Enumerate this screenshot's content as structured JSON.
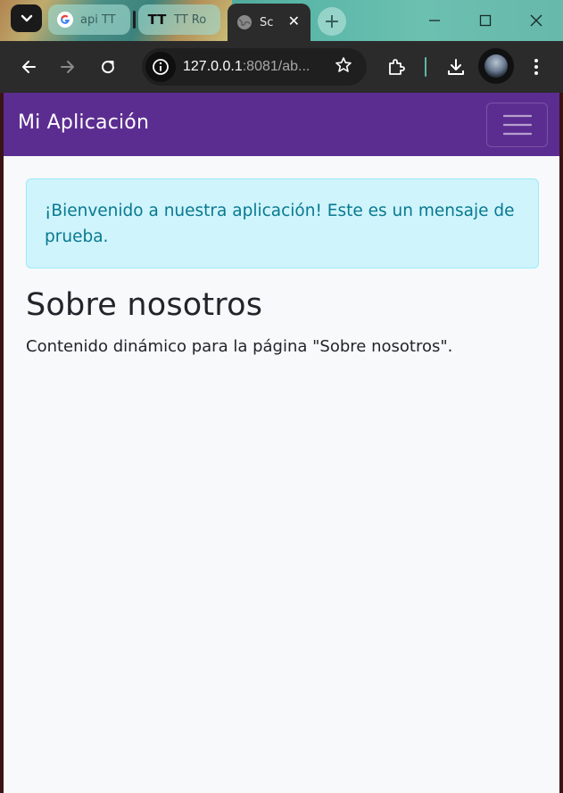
{
  "browser": {
    "tabs": [
      {
        "title": "api TT",
        "icon": "google-icon"
      },
      {
        "title": "TT Ro",
        "icon": "tt-icon",
        "icon_text": "TT"
      },
      {
        "title": "Sc",
        "icon": "globe-icon",
        "active": true
      }
    ],
    "address": {
      "host": "127.0.0.1",
      "rest": ":8081/ab..."
    }
  },
  "navbar": {
    "brand": "Mi Aplicación",
    "background": "#5c2d91"
  },
  "alert": {
    "message": "¡Bienvenido a nuestra aplicación! Este es un mensaje de prueba."
  },
  "main": {
    "heading": "Sobre nosotros",
    "content": "Contenido dinámico para la página \"Sobre nosotros\"."
  }
}
